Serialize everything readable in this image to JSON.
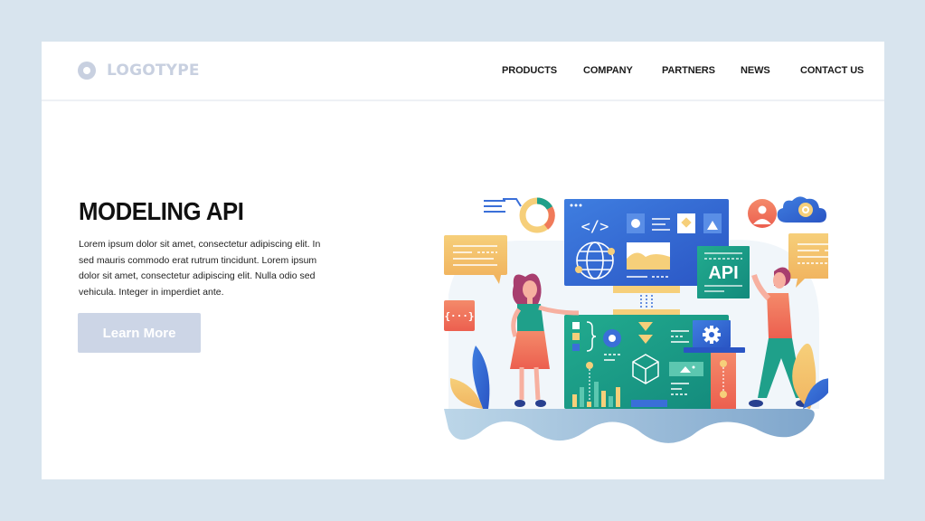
{
  "header": {
    "logo_text": "LOGOTYPE",
    "nav": [
      {
        "label": "PRODUCTS"
      },
      {
        "label": "COMPANY"
      },
      {
        "label": "PARTNERS"
      },
      {
        "label": "NEWS"
      },
      {
        "label": "CONTACT US"
      }
    ]
  },
  "hero": {
    "title": "MODELING API",
    "body": "Lorem ipsum dolor sit amet, consectetur adipiscing elit. In sed mauris commodo erat rutrum tincidunt. Lorem ipsum dolor sit amet, consectetur adipiscing elit. Nulla  odio sed vehicula. Integer in imperdiet ante.",
    "cta_label": "Learn More"
  },
  "illustration": {
    "api_label": "API",
    "code_badge": "{···}",
    "code_icon": "</>"
  },
  "colors": {
    "background": "#d8e4ee",
    "card": "#ffffff",
    "logo": "#c8d0e0",
    "button": "#ccd5e6",
    "blue": "#3a6fd8",
    "teal": "#1fa08a",
    "orange": "#f07a5a",
    "yellow": "#f2c46a"
  }
}
